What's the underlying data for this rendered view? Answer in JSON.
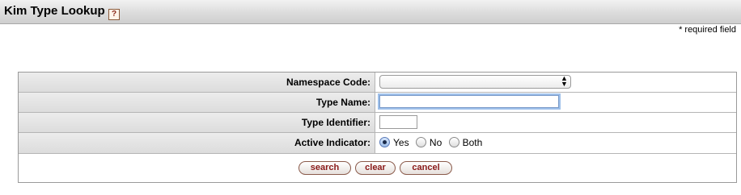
{
  "header": {
    "title": "Kim Type Lookup",
    "help_icon": "?"
  },
  "required_note": "* required field",
  "form": {
    "namespace_code": {
      "label": "Namespace Code:",
      "value": ""
    },
    "type_name": {
      "label": "Type Name:",
      "value": ""
    },
    "type_identifier": {
      "label": "Type Identifier:",
      "value": ""
    },
    "active_indicator": {
      "label": "Active Indicator:",
      "options": [
        "Yes",
        "No",
        "Both"
      ],
      "selected": "Yes"
    }
  },
  "buttons": {
    "search": "search",
    "clear": "clear",
    "cancel": "cancel"
  },
  "colors": {
    "button_text": "#8a1a1a",
    "focus_ring": "#9ec0ea"
  },
  "icons": {
    "help": "help-icon",
    "select_arrows": "select-arrows-icon"
  }
}
